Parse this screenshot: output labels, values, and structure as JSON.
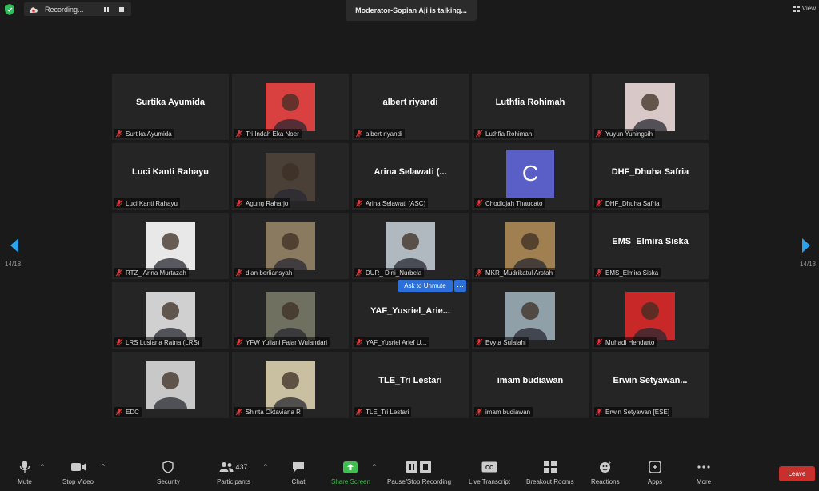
{
  "top": {
    "recording_label": "Recording...",
    "talking": "Moderator-Sopian Aji is talking...",
    "view_label": "View"
  },
  "pagination": {
    "left": "14/18",
    "right": "14/18"
  },
  "tiles": [
    {
      "big": "Surtika Ayumida",
      "label": "Surtika Ayumida"
    },
    {
      "photo": true,
      "label": "Tri Indah Eka Noer",
      "color": "#d94040"
    },
    {
      "big": "albert riyandi",
      "label": "albert riyandi"
    },
    {
      "big": "Luthfia Rohimah",
      "label": "Luthfia Rohimah"
    },
    {
      "photo": true,
      "label": "Yuyun Yuningsih",
      "color": "#d8c8c8"
    },
    {
      "big": "Luci Kanti Rahayu",
      "label": "Luci Kanti Rahayu"
    },
    {
      "photo": true,
      "label": "Agung Raharjo",
      "color": "#4a4038"
    },
    {
      "big": "Arina Selawati (...",
      "label": "Arina Selawati (ASC)"
    },
    {
      "avatar": "C",
      "label": "Chodidjah Thaucato"
    },
    {
      "big": "DHF_Dhuha Safria",
      "label": "DHF_Dhuha Safria"
    },
    {
      "photo": true,
      "label": "RTZ_ Arina Murtazah",
      "color": "#e8e8e8"
    },
    {
      "photo": true,
      "label": "dian berliansyah",
      "color": "#8a7a60"
    },
    {
      "photo": true,
      "label": "DUR_ Dini_Nurbela",
      "color": "#b0b8c0"
    },
    {
      "photo": true,
      "label": "MKR_Mudrikatul Arsfah",
      "color": "#a08050"
    },
    {
      "big": "EMS_Elmira Siska",
      "label": "EMS_Elmira Siska"
    },
    {
      "photo": true,
      "label": "LRS Lusiana Ratna (LRS)",
      "color": "#d0d0d0"
    },
    {
      "photo": true,
      "label": "YFW Yuliani Fajar Wulandari",
      "color": "#707060"
    },
    {
      "big": "YAF_Yusriel_Arie...",
      "label": "YAF_Yusriel Arief U...",
      "unmute": "Ask to Unmute",
      "more": "···"
    },
    {
      "photo": true,
      "label": "Evyta Sulalahi",
      "color": "#90a0a8"
    },
    {
      "photo": true,
      "label": "Muhadi Hendarto",
      "color": "#c82828"
    },
    {
      "photo": true,
      "label": "EDC",
      "color": "#c8c8c8"
    },
    {
      "photo": true,
      "label": "Shinta Oktaviana R",
      "color": "#c8c0a0"
    },
    {
      "big": "TLE_Tri Lestari",
      "label": "TLE_Tri Lestari"
    },
    {
      "big": "imam budiawan",
      "label": "imam budiawan"
    },
    {
      "big": "Erwin Setyawan...",
      "label": "Erwin Setyawan [ESE]"
    }
  ],
  "toolbar": {
    "mute": "Mute",
    "stop_video": "Stop Video",
    "security": "Security",
    "participants": "Participants",
    "participants_count": "437",
    "chat": "Chat",
    "share_screen": "Share Screen",
    "pause_stop_recording": "Pause/Stop Recording",
    "live_transcript": "Live Transcript",
    "breakout_rooms": "Breakout Rooms",
    "reactions": "Reactions",
    "apps": "Apps",
    "more": "More",
    "leave": "Leave"
  },
  "colors": {
    "background": "#1a1a1a",
    "tile": "#252525",
    "accent_blue": "#2d6fd9",
    "share_green": "#3fbf4f",
    "leave_red": "#c9302c",
    "mic_off_red": "#e0383a"
  }
}
